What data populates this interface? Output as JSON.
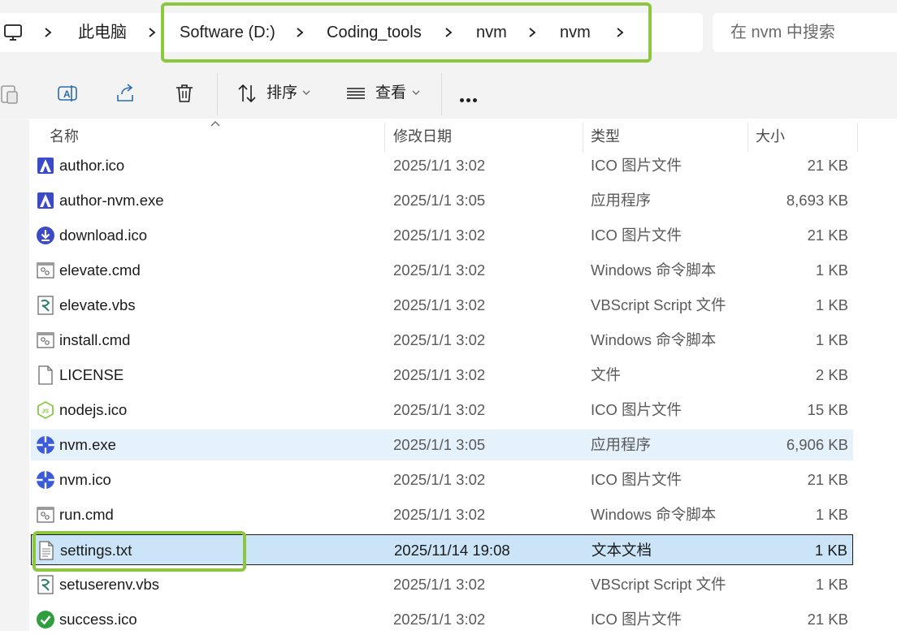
{
  "address": {
    "root_label": "此电脑",
    "crumbs": [
      "Software (D:)",
      "Coding_tools",
      "nvm",
      "nvm"
    ]
  },
  "search": {
    "placeholder": "在 nvm 中搜索"
  },
  "toolbar": {
    "sort_label": "排序",
    "view_label": "查看"
  },
  "columns": {
    "name": "名称",
    "date": "修改日期",
    "type": "类型",
    "size": "大小"
  },
  "files": [
    {
      "name": "author.ico",
      "date": "2025/1/1 3:02",
      "type": "ICO 图片文件",
      "size": "21 KB",
      "icon": "author-icon"
    },
    {
      "name": "author-nvm.exe",
      "date": "2025/1/1 3:05",
      "type": "应用程序",
      "size": "8,693 KB",
      "icon": "author-icon"
    },
    {
      "name": "download.ico",
      "date": "2025/1/1 3:02",
      "type": "ICO 图片文件",
      "size": "21 KB",
      "icon": "download-icon"
    },
    {
      "name": "elevate.cmd",
      "date": "2025/1/1 3:02",
      "type": "Windows 命令脚本",
      "size": "1 KB",
      "icon": "cmd-file-icon"
    },
    {
      "name": "elevate.vbs",
      "date": "2025/1/1 3:02",
      "type": "VBScript Script 文件",
      "size": "1 KB",
      "icon": "vbs-file-icon"
    },
    {
      "name": "install.cmd",
      "date": "2025/1/1 3:02",
      "type": "Windows 命令脚本",
      "size": "1 KB",
      "icon": "cmd-file-icon"
    },
    {
      "name": "LICENSE",
      "date": "2025/1/1 3:02",
      "type": "文件",
      "size": "2 KB",
      "icon": "blank-file-icon"
    },
    {
      "name": "nodejs.ico",
      "date": "2025/1/1 3:02",
      "type": "ICO 图片文件",
      "size": "15 KB",
      "icon": "nodejs-icon"
    },
    {
      "name": "nvm.exe",
      "date": "2025/1/1 3:05",
      "type": "应用程序",
      "size": "6,906 KB",
      "icon": "nvm-icon",
      "state": "hover"
    },
    {
      "name": "nvm.ico",
      "date": "2025/1/1 3:02",
      "type": "ICO 图片文件",
      "size": "21 KB",
      "icon": "nvm-icon"
    },
    {
      "name": "run.cmd",
      "date": "2025/1/1 3:02",
      "type": "Windows 命令脚本",
      "size": "1 KB",
      "icon": "cmd-file-icon"
    },
    {
      "name": "settings.txt",
      "date": "2025/11/14 19:08",
      "type": "文本文档",
      "size": "1 KB",
      "icon": "text-file-icon",
      "state": "selected"
    },
    {
      "name": "setuserenv.vbs",
      "date": "2025/1/1 3:02",
      "type": "VBScript Script 文件",
      "size": "1 KB",
      "icon": "vbs-file-icon"
    },
    {
      "name": "success.ico",
      "date": "2025/1/1 3:02",
      "type": "ICO 图片文件",
      "size": "21 KB",
      "icon": "success-icon"
    }
  ],
  "colors": {
    "annotation_highlight": "#8dc63f",
    "row_hover": "#e5f1fb",
    "row_selected": "#cce4f7",
    "nvm_blue": "#3b5bdb"
  }
}
